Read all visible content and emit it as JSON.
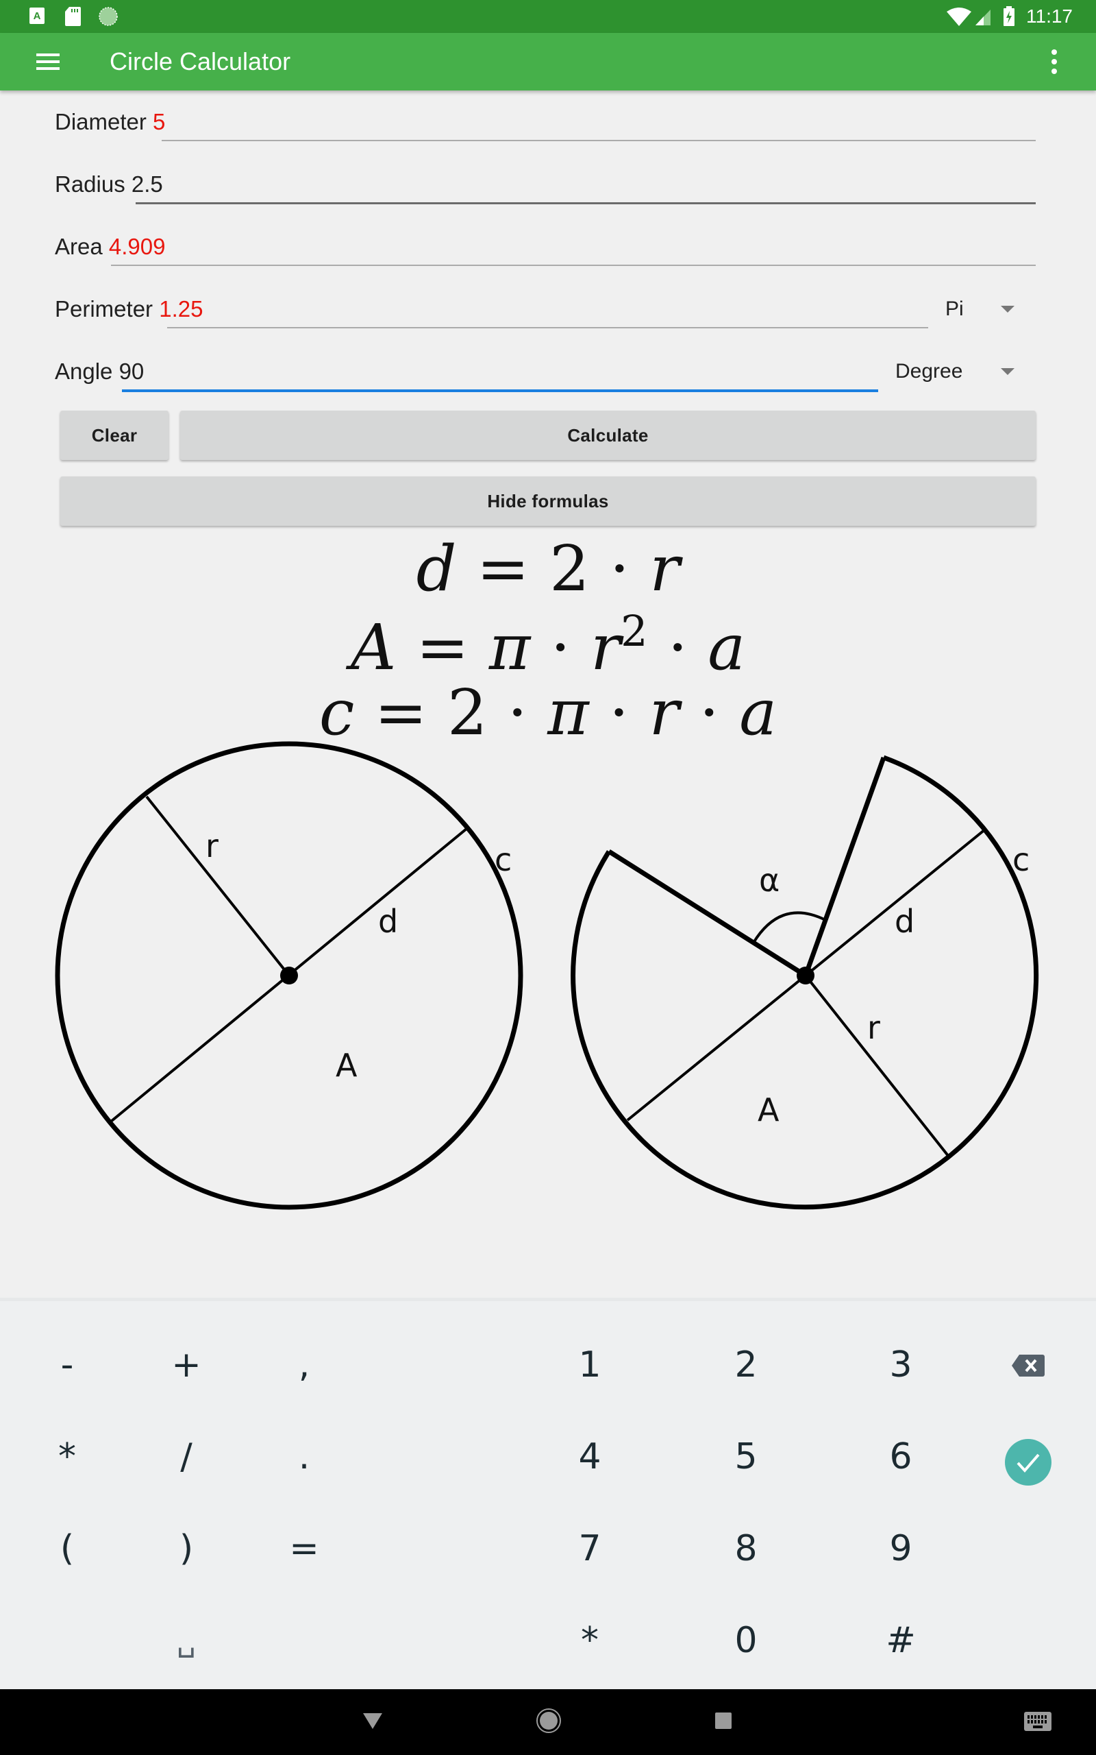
{
  "status_bar": {
    "time": "11:17",
    "left_icons": [
      "keyboard-a-icon",
      "sd-card-icon",
      "sync-icon"
    ],
    "right_icons": [
      "wifi-icon",
      "cell-signal-icon",
      "battery-charging-icon"
    ]
  },
  "app_bar": {
    "title": "Circle Calculator",
    "menu_icon": "hamburger-menu-icon",
    "overflow_icon": "more-vert-icon"
  },
  "fields": {
    "diameter": {
      "label": "Diameter",
      "value": "5",
      "value_color": "#e8170f"
    },
    "radius": {
      "label": "Radius",
      "value": "2.5",
      "value_color": "#212121"
    },
    "area": {
      "label": "Area",
      "value": "4.909",
      "value_color": "#e8170f"
    },
    "perimeter": {
      "label": "Perimeter",
      "value": "1.25",
      "value_color": "#e8170f",
      "unit_select": "Pi"
    },
    "angle": {
      "label": "Angle",
      "value": "90",
      "focused": true,
      "unit_select": "Degree"
    }
  },
  "buttons": {
    "clear": "Clear",
    "calculate": "Calculate",
    "hide_formulas": "Hide formulas"
  },
  "formulas": {
    "f1": {
      "lhs": "d",
      "rhs_parts": [
        "2",
        "r"
      ]
    },
    "f2": {
      "lhs": "A",
      "rhs_parts": [
        "π",
        "r",
        "a"
      ],
      "exponent": "2"
    },
    "f3": {
      "lhs": "c",
      "rhs_parts": [
        "2",
        "π",
        "r",
        "a"
      ]
    }
  },
  "diagrams": {
    "full_circle": {
      "labels": {
        "r": "r",
        "d": "d",
        "c": "c",
        "A": "A"
      }
    },
    "sector": {
      "labels": {
        "alpha": "α",
        "r": "r",
        "d": "d",
        "c": "c",
        "A": "A"
      }
    }
  },
  "keyboard": {
    "left_keys": [
      [
        "-",
        "+",
        ","
      ],
      [
        "*",
        "/",
        "."
      ],
      [
        "(",
        ")",
        "="
      ],
      [
        "",
        "␣",
        ""
      ]
    ],
    "num_keys": [
      [
        "1",
        "2",
        "3"
      ],
      [
        "4",
        "5",
        "6"
      ],
      [
        "7",
        "8",
        "9"
      ],
      [
        "*",
        "0",
        "#"
      ]
    ],
    "backspace_icon": "backspace-icon",
    "enter_icon": "check-circle-icon",
    "accent": "#4db6ac"
  },
  "nav_bar": {
    "icons": [
      "back-icon",
      "home-icon",
      "recents-icon",
      "keyboard-switch-icon"
    ]
  }
}
